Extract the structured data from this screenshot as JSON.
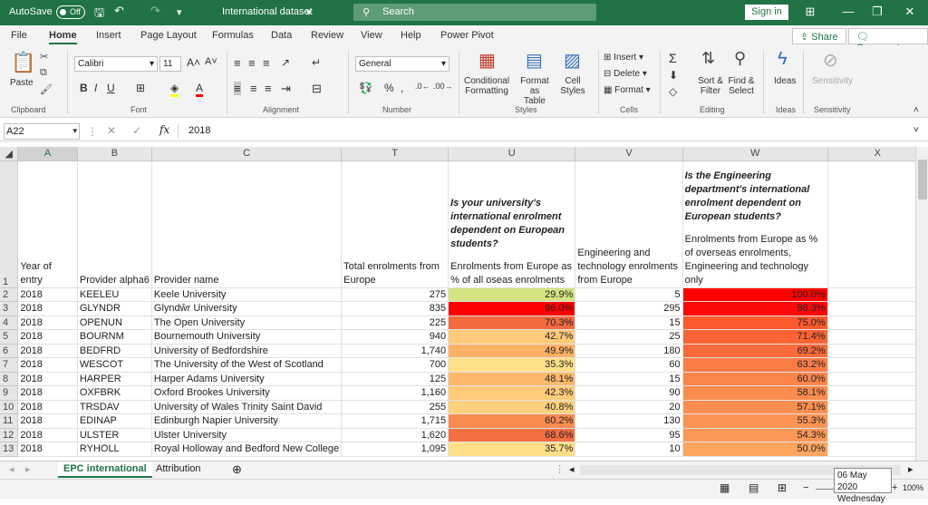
{
  "titlebar": {
    "autosave_label": "AutoSave",
    "autosave_state": "Off",
    "doc_title": "International dataset",
    "search_placeholder": "Search",
    "sign_in": "Sign in"
  },
  "menu": [
    "File",
    "Home",
    "Insert",
    "Page Layout",
    "Formulas",
    "Data",
    "Review",
    "View",
    "Help",
    "Power Pivot"
  ],
  "menu_active": "Home",
  "share_label": "Share",
  "comments_label": "Comments",
  "ribbon": {
    "paste": "Paste",
    "font_name": "Calibri",
    "font_size": "11",
    "number_format": "General",
    "conditional_formatting": [
      "Conditional",
      "Formatting"
    ],
    "format_as_table": [
      "Format as",
      "Table"
    ],
    "cell_styles": [
      "Cell",
      "Styles"
    ],
    "insert": "Insert",
    "delete": "Delete",
    "format": "Format",
    "sort_filter": [
      "Sort &",
      "Filter"
    ],
    "find_select": [
      "Find &",
      "Select"
    ],
    "ideas": "Ideas",
    "sensitivity": "Sensitivity",
    "groups": [
      "Clipboard",
      "Font",
      "Alignment",
      "Number",
      "Styles",
      "Cells",
      "Editing",
      "Ideas",
      "Sensitivity"
    ]
  },
  "formula_bar": {
    "name_box": "A22",
    "fx": "fx",
    "value": "2018"
  },
  "columns": [
    "A",
    "B",
    "C",
    "T",
    "U",
    "V",
    "W",
    "X"
  ],
  "header_row": {
    "row_num": "1",
    "a": "Year of entry",
    "b": "Provider alpha6",
    "c": "Provider name",
    "t": "Total enrolments from Europe",
    "u_question": "Is your university's international enrolment dependent on European students?",
    "u": "Enrolments from Europe as % of all oseas enrolments",
    "v": "Engineering and technology enrolments from Europe",
    "w_question": "Is the Engineering department's international enrolment dependent on European students?",
    "w": "Enrolments from Europe as % of overseas enrolments, Engineering and technology only"
  },
  "rows": [
    {
      "n": "2",
      "year": "2018",
      "alpha": "KEELEU",
      "name": "Keele University",
      "total": "275",
      "pct": "29.9%",
      "pct_color": "#d5e382",
      "eng": "5",
      "eng_pct": "100.0%",
      "eng_color": "#ff0000"
    },
    {
      "n": "3",
      "year": "2018",
      "alpha": "GLYNDR",
      "name": "Glyndŵr University",
      "total": "835",
      "pct": "96.0%",
      "pct_color": "#ff0000",
      "eng": "295",
      "eng_pct": "98.3%",
      "eng_color": "#ff0a0a"
    },
    {
      "n": "4",
      "year": "2018",
      "alpha": "OPENUN",
      "name": "The Open University",
      "total": "225",
      "pct": "70.3%",
      "pct_color": "#f4693e",
      "eng": "15",
      "eng_pct": "75.0%",
      "eng_color": "#fb5a2e"
    },
    {
      "n": "5",
      "year": "2018",
      "alpha": "BOURNM",
      "name": "Bournemouth University",
      "total": "940",
      "pct": "42.7%",
      "pct_color": "#ffca7a",
      "eng": "25",
      "eng_pct": "71.4%",
      "eng_color": "#fb6335"
    },
    {
      "n": "6",
      "year": "2018",
      "alpha": "BEDFRD",
      "name": "University of Bedfordshire",
      "total": "1,740",
      "pct": "49.9%",
      "pct_color": "#fdb167",
      "eng": "180",
      "eng_pct": "69.2%",
      "eng_color": "#fb6a3a"
    },
    {
      "n": "7",
      "year": "2018",
      "alpha": "WESCOT",
      "name": "The University of the West of Scotland",
      "total": "700",
      "pct": "35.3%",
      "pct_color": "#ffe08a",
      "eng": "60",
      "eng_pct": "63.2%",
      "eng_color": "#fc7c46"
    },
    {
      "n": "8",
      "year": "2018",
      "alpha": "HARPER",
      "name": "Harper Adams University",
      "total": "125",
      "pct": "48.1%",
      "pct_color": "#feb86c",
      "eng": "15",
      "eng_pct": "60.0%",
      "eng_color": "#fc854b"
    },
    {
      "n": "9",
      "year": "2018",
      "alpha": "OXFBRK",
      "name": "Oxford Brookes University",
      "total": "1,160",
      "pct": "42.3%",
      "pct_color": "#ffcb7b",
      "eng": "90",
      "eng_pct": "58.1%",
      "eng_color": "#fc8b4f"
    },
    {
      "n": "10",
      "year": "2018",
      "alpha": "TRSDAV",
      "name": "University of Wales Trinity Saint David",
      "total": "255",
      "pct": "40.8%",
      "pct_color": "#ffd07e",
      "eng": "20",
      "eng_pct": "57.1%",
      "eng_color": "#fc8e51"
    },
    {
      "n": "11",
      "year": "2018",
      "alpha": "EDINAP",
      "name": "Edinburgh Napier University",
      "total": "1,715",
      "pct": "60.2%",
      "pct_color": "#f98b50",
      "eng": "130",
      "eng_pct": "55.3%",
      "eng_color": "#fd9455"
    },
    {
      "n": "12",
      "year": "2018",
      "alpha": "ULSTER",
      "name": "Ulster University",
      "total": "1,620",
      "pct": "68.6%",
      "pct_color": "#f56e41",
      "eng": "95",
      "eng_pct": "54.3%",
      "eng_color": "#fd9757"
    },
    {
      "n": "13",
      "year": "2018",
      "alpha": "RYHOLL",
      "name": "Royal Holloway and Bedford New College",
      "total": "1,095",
      "pct": "35.7%",
      "pct_color": "#ffdf89",
      "eng": "10",
      "eng_pct": "50.0%",
      "eng_color": "#fda55f"
    }
  ],
  "sheet_tabs": [
    "EPC international",
    "Attribution"
  ],
  "active_tab": "EPC international",
  "tooltip": {
    "date": "06 May 2020",
    "day": "Wednesday"
  },
  "zoom": "100%"
}
